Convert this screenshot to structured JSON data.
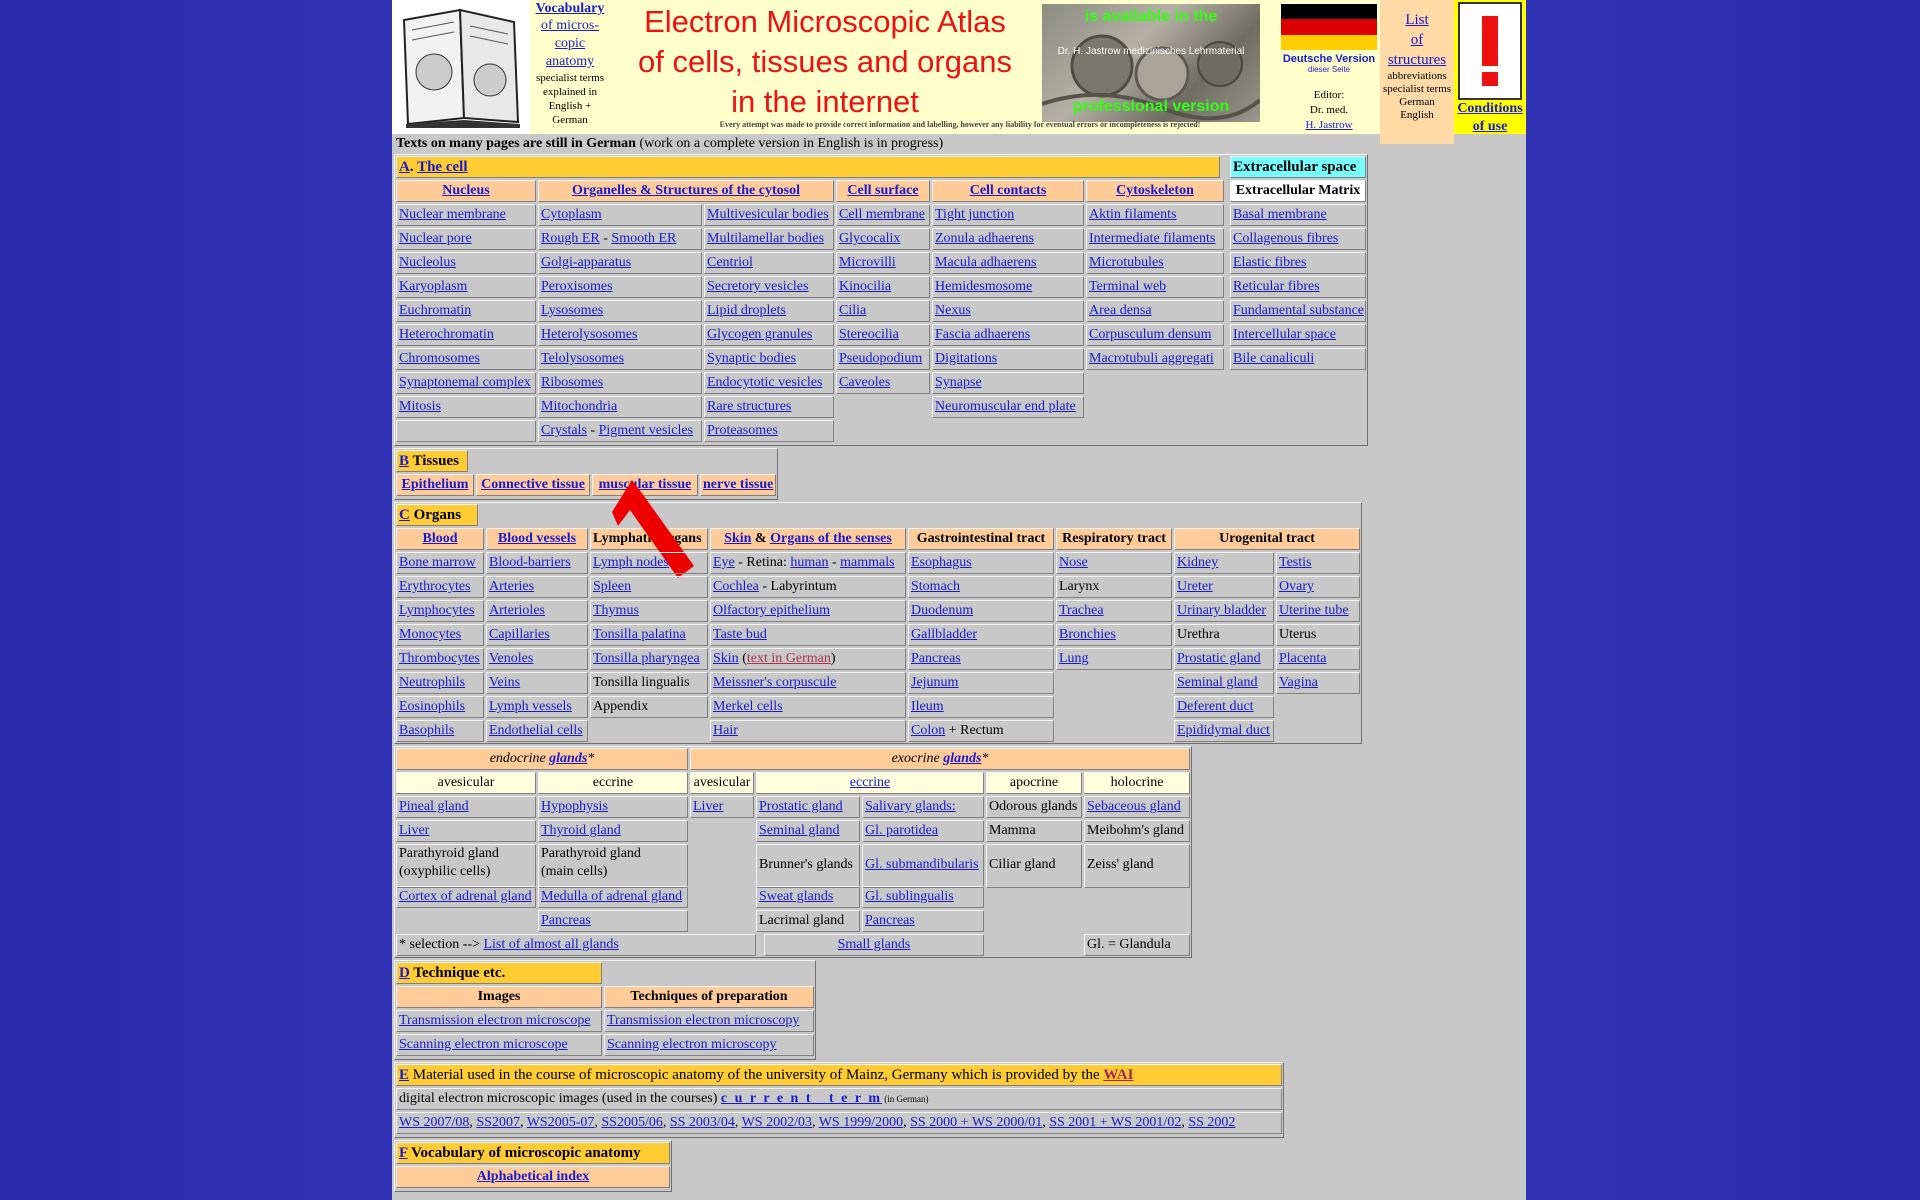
{
  "header": {
    "vocab": {
      "title": "Vocabulary",
      "l2": "of micros-",
      "l3": "copic",
      "l4": "anatomy",
      "sub1": "specialist terms",
      "sub2": "explained in",
      "sub3": "English +",
      "sub4": "German"
    },
    "title": [
      "Electron Microscopic Atlas",
      "of cells, tissues and organs",
      "in the internet"
    ],
    "image_text": {
      "top": "is available in the",
      "middle": "Dr. H. Jastrow medizinisches Lehrmaterial",
      "bottom": "professional version"
    },
    "disclaimer": "Every attempt was made to provide correct information and labelling, however any liability for eventual errors or incompleteness is rejected!",
    "deutsch": {
      "label": "Deutsche Version",
      "sub": "dieser Seite"
    },
    "editor": {
      "l1": "Editor:",
      "l2": "Dr. med.",
      "l3": "H. Jastrow"
    },
    "list": {
      "l1": "List",
      "l2": "of",
      "l3": "structures",
      "s1": "abbreviations",
      "s2": "specialist terms",
      "s3": "German",
      "s4": "English"
    },
    "conditions": {
      "l1": "Conditions",
      "l2": "of use"
    },
    "flag_colors": [
      "#000000",
      "#dd0000",
      "#ffce00"
    ]
  },
  "note": {
    "bold": "Texts on many pages are still in German",
    "rest": " (work on a complete version in English is in progress)"
  },
  "secA": {
    "letter": "A",
    "title": "The cell",
    "extra": "Extracellular space",
    "heads": [
      "Nucleus",
      "Organelles & Structures of the cytosol",
      "Cell surface",
      "Cell contacts",
      "Cytoskeleton",
      "Extracellular Matrix"
    ],
    "col1": [
      "Nuclear membrane",
      "Nuclear pore",
      "Nucleolus",
      "Karyoplasm",
      "Euchromatin",
      "Heterochromatin",
      "Chromosomes",
      "Synaptonemal complex",
      "Mitosis"
    ],
    "col2": [
      "Cytoplasm",
      "Rough ER",
      "Smooth ER",
      "Golgi-apparatus",
      "Peroxisomes",
      "Lysosomes",
      "Heterolysosomes",
      "Telolysosomes",
      "Ribosomes",
      "Mitochondria",
      "Crystals",
      "Pigment vesicles"
    ],
    "col3": [
      "Multivesicular bodies",
      "Multilamellar bodies",
      "Centriol",
      "Secretory vesicles",
      "Lipid droplets",
      "Glycogen granules",
      "Synaptic bodies",
      "Endocytotic vesicles",
      "Rare structures",
      "Proteasomes"
    ],
    "col4": [
      "Cell membrane",
      "Glycocalix",
      "Microvilli",
      "Kinocilia",
      "Cilia",
      "Stereocilia",
      "Pseudopodium",
      "Caveoles"
    ],
    "col5": [
      "Tight junction",
      "Zonula adhaerens",
      "Macula adhaerens",
      "Hemidesmosome",
      "Nexus",
      "Fascia adhaerens",
      "Digitations",
      "Synapse",
      "Neuromuscular end plate"
    ],
    "col6": [
      "Aktin filaments",
      "Intermediate filaments",
      "Microtubules",
      "Terminal web",
      "Area densa",
      "Corpusculum densum",
      "Macrotubuli aggregati"
    ],
    "col7": [
      "Basal membrane",
      "Collagenous fibres",
      "Elastic fibres",
      "Reticular fibres",
      "Fundamental substance",
      "Intercellular space",
      "Bile canaliculi"
    ]
  },
  "secB": {
    "letter": "B",
    "title": " Tissues",
    "items": [
      "Epithelium",
      "Connective tissue",
      "muscular tissue",
      "nerve tissue"
    ]
  },
  "secC": {
    "letter": "C",
    "title": " Organs",
    "heads": {
      "blood": "Blood",
      "vessels": "Blood vessels",
      "lymph": "Lymphatic organs",
      "skin": "Skin",
      "amp": " & ",
      "senses": "Organs of the senses",
      "gi": "Gastrointestinal tract",
      "resp": "Respiratory tract",
      "uro": "Urogenital tract"
    },
    "blood": [
      "Bone marrow",
      "Erythrocytes",
      "Lymphocytes",
      "Monocytes",
      "Thrombocytes",
      "Neutrophils",
      "Eosinophils",
      "Basophils"
    ],
    "vessels": [
      "Blood-barriers",
      "Arteries",
      "Arterioles",
      "Capillaries",
      "Venoles",
      "Veins",
      "Lymph vessels",
      "Endothelial cells"
    ],
    "lymph": [
      "Lymph nodes",
      "Spleen",
      "Thymus",
      "Tonsilla palatina",
      "Tonsilla pharyngea",
      "Tonsilla lingualis",
      "Appendix"
    ],
    "senses": {
      "eye": "Eye",
      "retina": " - Retina: ",
      "human": "human",
      "dash": " - ",
      "mammals": "mammals",
      "cochlea": "Cochlea",
      "laby": " - Labyrintum",
      "olf": "Olfactory epithelium",
      "taste": "Taste bud",
      "skin": "Skin",
      "german": "text in German",
      "meissner": "Meissner's corpuscule",
      "merkel": "Merkel cells",
      "hair": "Hair"
    },
    "gi": [
      "Esophagus",
      "Stomach",
      "Duodenum",
      "Gallbladder",
      "Pancreas",
      "Jejunum",
      "Ileum",
      "Colon"
    ],
    "gi_rectum": " + Rectum",
    "resp": [
      "Nose",
      "Larynx",
      "Trachea",
      "Bronchies",
      "Lung"
    ],
    "uro1": [
      "Kidney",
      "Ureter",
      "Urinary bladder",
      "Urethra",
      "Prostatic gland",
      "Seminal gland",
      "Deferent duct",
      "Epididymal duct"
    ],
    "uro2": [
      "Testis",
      "Ovary",
      "Uterine tube",
      "Uterus",
      "Placenta",
      "Vagina"
    ]
  },
  "glands": {
    "endo": "endocrine ",
    "exo": "exocrine ",
    "glands": "glands",
    "star": "*",
    "sub": [
      "avesicular",
      "eccrine",
      "avesicular",
      "eccrine",
      "apocrine",
      "holocrine"
    ],
    "endo_av": [
      "Pineal gland",
      "Liver",
      "Parathyroid gland",
      "(oxyphilic cells)",
      "Cortex of adrenal gland"
    ],
    "endo_ecc": [
      "Hypophysis",
      "Thyroid gland",
      "Parathyroid gland",
      "(main cells)",
      "Medulla of adrenal gland",
      "Pancreas"
    ],
    "exo_av": [
      "Liver"
    ],
    "exo_ecc1": [
      "Prostatic gland",
      "Seminal gland",
      "Brunner's glands",
      "Sweat glands",
      "Lacrimal gland"
    ],
    "exo_ecc2": [
      "Salivary glands:",
      "Gl. parotidea",
      "Gl. submandibularis",
      "Gl. sublingualis",
      "Pancreas"
    ],
    "apo": [
      "Odorous glands",
      "Mamma",
      "Ciliar gland"
    ],
    "holo": [
      "Sebaceous gland",
      "Meibohm's gland",
      "Zeiss' gland"
    ],
    "sel": "* selection --> ",
    "sel_link": "List of almost all glands",
    "small": "Small glands",
    "gl": "Gl. = Glandula"
  },
  "secD": {
    "letter": "D",
    "title": " Technique etc.",
    "heads": [
      "Images",
      "Techniques of preparation"
    ],
    "rows": [
      [
        "Transmission electron microscope",
        "Transmission electron microscopy"
      ],
      [
        "Scanning electron microscope",
        "Scanning electron microscopy"
      ]
    ]
  },
  "secE": {
    "letter": "E",
    "title": " Material used in the course of microscopic anatomy of the university of Mainz, Germany which is provided by the ",
    "wai": "WAI",
    "digital": "digital electron microscopic images (used in the courses) ",
    "current": "c u r r e n t   t e r m",
    "ing": " (in German)",
    "terms": [
      "WS 2007/08",
      "SS2007",
      "WS2005-07",
      "SS2005/06",
      "SS 2003/04",
      "WS 2002/03",
      "WS 1999/2000",
      "SS 2000 + WS 2000/01",
      "SS 2001 + WS 2001/02",
      "SS 2002"
    ]
  },
  "secF": {
    "letter": "F",
    "title": " Vocabulary of microscopic anatomy",
    "link": "Alphabetical index"
  },
  "colors": {
    "background": "#2a2bb0",
    "panel": "#c8c8c8",
    "header_yellow": "#ffcc33",
    "header_orange": "#ffcc99",
    "cyan": "#77ffff",
    "link": "#1a1acc",
    "title_red": "#ee1111",
    "arrow": "#ee0000"
  }
}
